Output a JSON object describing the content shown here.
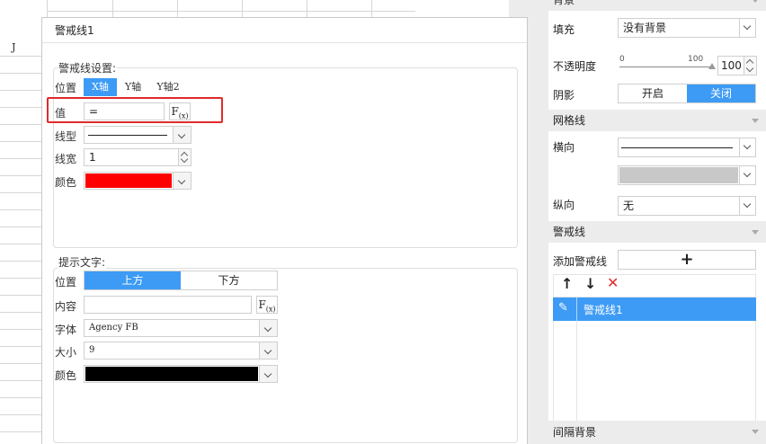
{
  "sheet": {
    "column_header": "J"
  },
  "dialog": {
    "title": "警戒线1",
    "line_settings": {
      "title": "警戒线设置:",
      "position_label": "位置",
      "axis_tabs": [
        "X轴",
        "Y轴",
        "Y轴2"
      ],
      "value_label": "值",
      "value": "=",
      "formula_button": "F(x)",
      "line_type_label": "线型",
      "line_width_label": "线宽",
      "line_width": "1",
      "color_label": "颜色",
      "color": "#ff0000"
    },
    "hint_text": {
      "title": "提示文字:",
      "position_label": "位置",
      "position_options": [
        "上方",
        "下方"
      ],
      "content_label": "内容",
      "content": "",
      "formula_button": "F(x)",
      "font_label": "字体",
      "font": "Agency FB",
      "size_label": "大小",
      "size": "9",
      "color_label": "颜色",
      "color": "#000000"
    }
  },
  "panel": {
    "top_section": "背景",
    "fill_label": "填充",
    "fill_value": "没有背景",
    "opacity_label": "不透明度",
    "opacity_min": "0",
    "opacity_max": "100",
    "opacity_value": "100",
    "shadow_label": "阴影",
    "shadow_options": [
      "开启",
      "关闭"
    ],
    "grid_section": "网格线",
    "horizontal_label": "横向",
    "grid_color": "#c8c8c8",
    "vertical_label": "纵向",
    "vertical_value": "无",
    "warning_section": "警戒线",
    "add_warning_label": "添加警戒线",
    "add_button": "+",
    "warning_items": [
      "警戒线1"
    ],
    "interval_section": "间隔背景",
    "accent": "#3d9bf5"
  }
}
